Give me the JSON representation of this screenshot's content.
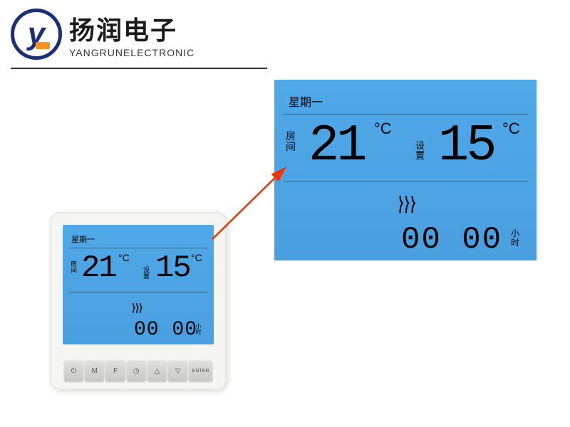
{
  "logo": {
    "letter": "y",
    "chinese": "扬润电子",
    "english": "YANGRUNELECTRONIC"
  },
  "screen": {
    "day": "星期一",
    "room_label": "房间",
    "room_temp": "21",
    "degree_c": "°C",
    "set_label": "设置",
    "set_temp": "15",
    "heat_icon": "∿",
    "time": "00 00",
    "hours_label": "小时"
  },
  "buttons": {
    "power": "⏻",
    "mode": "M",
    "f": "F",
    "clock": "◷",
    "up": "△",
    "down": "▽",
    "enter": "ENTER"
  }
}
